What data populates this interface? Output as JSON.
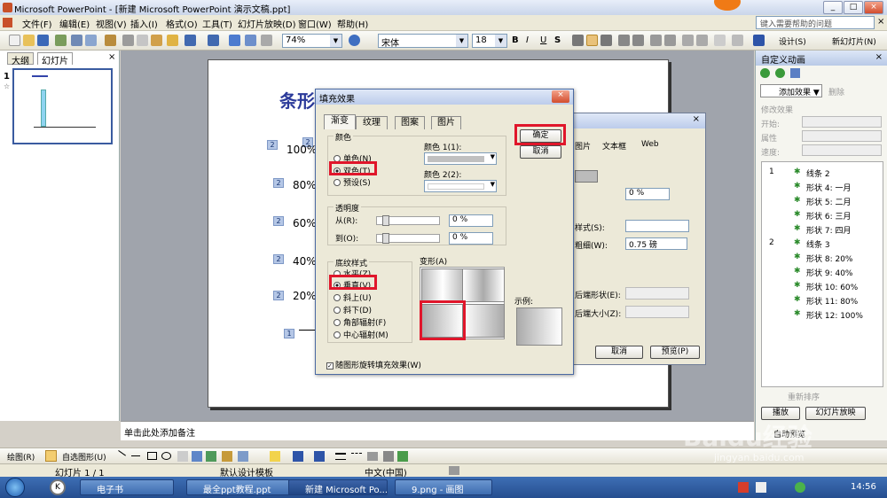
{
  "titlebar": {
    "title": "Microsoft PowerPoint - [新建 Microsoft PowerPoint 演示文稿.ppt]",
    "min": "_",
    "max": "□",
    "close": "×"
  },
  "menu": {
    "items": [
      "文件(F)",
      "编辑(E)",
      "视图(V)",
      "插入(I)",
      "格式(O)",
      "工具(T)",
      "幻灯片放映(D)",
      "窗口(W)",
      "帮助(H)"
    ],
    "help_placeholder": "键入需要帮助的问题"
  },
  "toolbar": {
    "zoom": "74%",
    "font": "宋体",
    "font_size": "18",
    "bold": "B",
    "italic": "I",
    "underline": "U",
    "shadow": "S",
    "design": "设计(S)",
    "new_slide": "新幻灯片(N)"
  },
  "leftpane": {
    "tab_outline": "大纲",
    "tab_slides": "幻灯片",
    "slide_num": "1",
    "slide_icon": "☆"
  },
  "slide": {
    "title_partial": "条形",
    "tags": [
      "2",
      "2",
      "2",
      "2",
      "2",
      "2",
      "1"
    ],
    "labels": [
      "100%",
      "80%",
      "60%",
      "40%",
      "20%"
    ]
  },
  "notes": {
    "placeholder": "单击此处添加备注"
  },
  "taskpane": {
    "title": "自定义动画",
    "add_effect": "添加效果",
    "remove": "删除",
    "modify": "修改效果",
    "start": "开始:",
    "property": "属性",
    "speed": "速度:",
    "items": [
      {
        "num": "1",
        "label": "线条 2"
      },
      {
        "num": "",
        "label": "形状 4: 一月"
      },
      {
        "num": "",
        "label": "形状 5: 二月"
      },
      {
        "num": "",
        "label": "形状 6: 三月"
      },
      {
        "num": "",
        "label": "形状 7: 四月"
      },
      {
        "num": "2",
        "label": "线条 3"
      },
      {
        "num": "",
        "label": "形状 8: 20%"
      },
      {
        "num": "",
        "label": "形状 9: 40%"
      },
      {
        "num": "",
        "label": "形状 10: 60%"
      },
      {
        "num": "",
        "label": "形状 11: 80%"
      },
      {
        "num": "",
        "label": "形状 12: 100%"
      }
    ],
    "reorder": "重新排序",
    "play": "播放",
    "slideshow": "幻灯片放映",
    "autopreview": "自动预览"
  },
  "backdialog": {
    "tab_picture": "图片",
    "tab_textbox": "文本框",
    "tab_web": "Web",
    "percent": "0 %",
    "style": "样式(S):",
    "weight": "粗细(W):",
    "weight_val": "0.75 磅",
    "end_shape": "后端形状(E):",
    "end_size": "后端大小(Z):",
    "cancel": "取消",
    "preview": "预览(P)"
  },
  "dialog": {
    "title": "填充效果",
    "tabs": [
      "渐变",
      "纹理",
      "图案",
      "图片"
    ],
    "color_group": "颜色",
    "one_color": "单色(N)",
    "two_colors": "双色(T)",
    "preset": "预设(S)",
    "color1": "颜色 1(1):",
    "color2": "颜色 2(2):",
    "transparency": "透明度",
    "from": "从(R):",
    "to": "到(O):",
    "from_val": "0 %",
    "to_val": "0 %",
    "shading_group": "底纹样式",
    "horizontal": "水平(Z)",
    "vertical": "垂直(V)",
    "diag_up": "斜上(U)",
    "diag_down": "斜下(D)",
    "from_corner": "角部辐射(F)",
    "from_center": "中心辐射(M)",
    "variants": "变形(A)",
    "sample": "示例:",
    "ok": "确定",
    "cancel": "取消",
    "rotate": "随图形旋转填充效果(W)"
  },
  "drawbar": {
    "draw": "绘图(R)",
    "autoshape": "自选图形(U)"
  },
  "statusbar": {
    "slide": "幻灯片 1 / 1",
    "template": "默认设计模板",
    "lang": "中文(中国)"
  },
  "taskbar": {
    "items": [
      "电子书",
      "最全ppt教程.ppt",
      "新建 Microsoft Po...",
      "9.png - 画图"
    ],
    "time": "14:56"
  },
  "watermark": {
    "brand": "Baidu经验",
    "url": "jingyan.baidu.com"
  }
}
